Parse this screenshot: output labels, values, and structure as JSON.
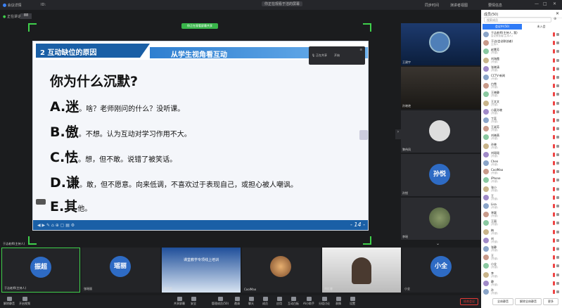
{
  "window": {
    "left_status": "会议详情",
    "meeting_id": "ID:",
    "center_title": "你正在观看于洁的屏幕",
    "right_info": "同步时间",
    "layout_label": "演讲者视图",
    "user_label": "要情信息"
  },
  "topbar_left": {
    "speaker_label": "正在讲话:",
    "grid_label": "88"
  },
  "share": {
    "tag": "你正在观看屏幕共享",
    "slide_title": "2 互动缺位的原因",
    "slide_subtitle": "从学生视角看互动",
    "question": "你为什么沉默?",
    "lines": [
      {
        "key": "A.迷",
        "text": "。啥？老师刚问的什么？没听课。"
      },
      {
        "key": "B.傲",
        "text": "。不想。认为互动对学习作用不大。"
      },
      {
        "key": "C.怯",
        "text": "。想，但不敢。说错了被笑话。"
      },
      {
        "key": "D.谦",
        "text": "。敢，但不愿意。向来低调，不喜欢过于表现自己，或担心被人嘲讽。"
      },
      {
        "key": "E.其",
        "text": "他。"
      }
    ],
    "page": "- 14 -",
    "mini_title": "正在共享",
    "mini_stop": "开始"
  },
  "right_videos": [
    {
      "name": "王建宇",
      "type": "photo"
    },
    {
      "name": "孙晓艳",
      "type": "photo"
    },
    {
      "name": "黎伟凤",
      "type": "placeholder"
    },
    {
      "name": "孙悦",
      "type": "avatar",
      "avatar": "孙悦"
    },
    {
      "name": "李瑶",
      "type": "photo"
    }
  ],
  "bottom_videos": [
    {
      "name": "于洁老师(主持人)",
      "avatar": "振超",
      "label": "振超"
    },
    {
      "name": "张瑶丽",
      "avatar": "瑶丽",
      "label": "瑶丽"
    },
    {
      "name": "徐兰芳",
      "avatar": "",
      "label": "课堂教学专项线上培训"
    },
    {
      "name": "CoolMao",
      "avatar": "",
      "label": ""
    },
    {
      "name": "刘红娜",
      "avatar": "",
      "label": ""
    },
    {
      "name": "小全",
      "avatar": "小全",
      "label": "小全"
    }
  ],
  "host_label": "于洁老师(主持人)",
  "bottombar": {
    "left": [
      "解除静音",
      "开启视频"
    ],
    "center": [
      "共享屏幕",
      "安全",
      "管理成员(50)",
      "邀请",
      "聊天",
      "成员",
      "应用",
      "互动白板",
      "AI小助手",
      "分组讨论",
      "表情",
      "设置"
    ],
    "end_label": "结束会议"
  },
  "panel": {
    "title": "成员(50)",
    "search_placeholder": "搜索成员",
    "tab_active": "会议中(50)",
    "tab_inactive": "未入会",
    "members": [
      {
        "name": "于洁老师(主持人, 我)",
        "role": "会议联创者(主持人)"
      },
      {
        "name": "于洁(会议联创者)",
        "role": "主持人"
      },
      {
        "name": "赵慧芳",
        "role": "(外部)"
      },
      {
        "name": "刘海霞",
        "role": "(外部)"
      },
      {
        "name": "张晓清",
        "role": "(外部)"
      },
      {
        "name": "CCTV-新闻",
        "role": "(外部)"
      },
      {
        "name": "白雪",
        "role": "(外部)"
      },
      {
        "name": "王晓静",
        "role": "(外部)"
      },
      {
        "name": "王文文",
        "role": "(外部)"
      },
      {
        "name": "小麦孙晓",
        "role": "(外部)"
      },
      {
        "name": "丁蕊",
        "role": "(外部)"
      },
      {
        "name": "王淑芳",
        "role": "(外部)"
      },
      {
        "name": "刘晓燕",
        "role": "(外部)"
      },
      {
        "name": "孙晓",
        "role": "(外部)"
      },
      {
        "name": "刘瑶瑶",
        "role": "(外部)"
      },
      {
        "name": "Chen",
        "role": "(外部)"
      },
      {
        "name": "CoolMao",
        "role": "(外部)"
      },
      {
        "name": "iPhone",
        "role": "(外部)"
      },
      {
        "name": "张小",
        "role": "(外部)"
      },
      {
        "name": "王",
        "role": "(外部)"
      },
      {
        "name": "Lisa",
        "role": "(外部)"
      },
      {
        "name": "李颖",
        "role": "(外部)"
      },
      {
        "name": "王丽",
        "role": "(外部)"
      },
      {
        "name": "梅",
        "role": "(外部)"
      },
      {
        "name": "刘",
        "role": "(外部)"
      },
      {
        "name": "张静",
        "role": "(外部)"
      },
      {
        "name": "王",
        "role": "(外部)"
      },
      {
        "name": "小全",
        "role": "(外部)"
      },
      {
        "name": "李",
        "role": "(外部)"
      },
      {
        "name": "静",
        "role": "(外部)"
      },
      {
        "name": "孙",
        "role": "(外部)"
      }
    ],
    "mute_all": "全体静音",
    "unmute_all": "解除全体静音",
    "more": "更多"
  },
  "colors": {
    "accent": "#2f7bf6",
    "slide_blue": "#1a5fa6",
    "active_border": "#3fd04b",
    "end_red": "#e53935"
  }
}
